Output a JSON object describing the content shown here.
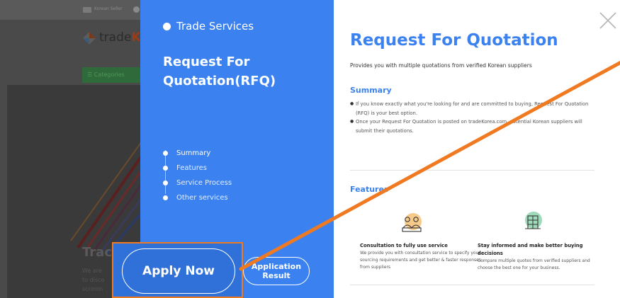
{
  "background": {
    "seller_text": "Korean Seller",
    "brand_prefix": "trade",
    "brand_suffix": "K",
    "categories_label": "☰ Categories",
    "hero_title": "Trac",
    "hero_sub_lines": [
      "We are",
      "to disco",
      "scrimin"
    ]
  },
  "sidebar": {
    "section_label": "Trade Services",
    "title": "Request For Quotation(RFQ)",
    "nav": [
      {
        "label": "Summary",
        "active": true
      },
      {
        "label": "Features",
        "active": false
      },
      {
        "label": "Service Process",
        "active": false
      },
      {
        "label": "Other services",
        "active": false
      }
    ],
    "apply_label": "Apply Now",
    "result_label_line1": "Application",
    "result_label_line2": "Result"
  },
  "content": {
    "title": "Request For Quotation",
    "lead": "Provides you with multiple quotations from verified Korean suppliers",
    "summary_heading": "Summary",
    "summary_bullets": [
      "If you know exactly what you're looking for and are committed to buying, Request For Quotation (RFQ) is your best option.",
      "Once your Request For Quotation is posted on tradeKorea.com, potential Korean suppliers will submit their quotations."
    ],
    "features_heading": "Features",
    "features": [
      {
        "icon": "consultation-icon",
        "title": "Consultation to fully use service",
        "desc": "We provide you with consultation service to specify your sourcing requirements and get better & faster responses from suppliers"
      },
      {
        "icon": "globe-building-icon",
        "title": "Stay informed and make better buying decisions",
        "desc": "Compare multiple quotes from verified suppliers and choose the best one for your business."
      }
    ]
  },
  "colors": {
    "primary_blue": "#3b82f0",
    "annotation_orange": "#f07a22",
    "overlay_gray": "#4a4a4a"
  }
}
